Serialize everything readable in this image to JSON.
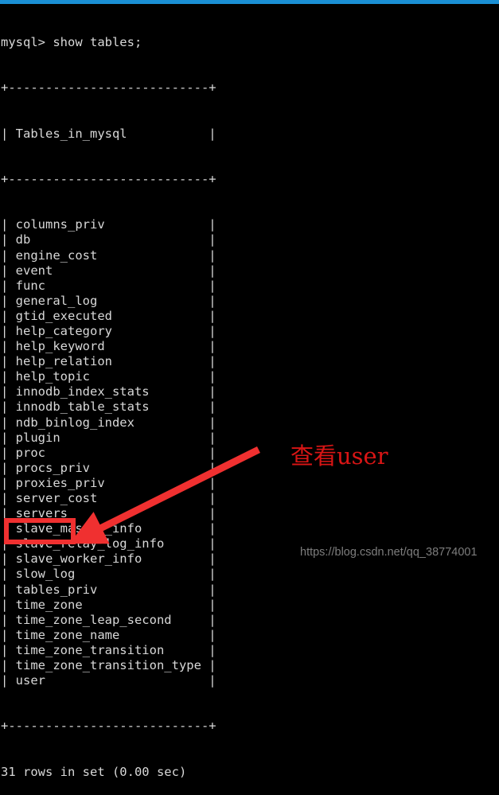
{
  "window": {
    "top_bar_color": "#1a8fd4",
    "background_color": "#000000",
    "text_color": "#d8d8d8",
    "accent_red": "#f03030"
  },
  "terminal": {
    "prompt_line": "mysql> show tables;",
    "separator": "+---------------------------+",
    "header_row": "| Tables_in_mysql           |",
    "column_header": "Tables_in_mysql",
    "rows": [
      "columns_priv",
      "db",
      "engine_cost",
      "event",
      "func",
      "general_log",
      "gtid_executed",
      "help_category",
      "help_keyword",
      "help_relation",
      "help_topic",
      "innodb_index_stats",
      "innodb_table_stats",
      "ndb_binlog_index",
      "plugin",
      "proc",
      "procs_priv",
      "proxies_priv",
      "server_cost",
      "servers",
      "slave_master_info",
      "slave_relay_log_info",
      "slave_worker_info",
      "slow_log",
      "tables_priv",
      "time_zone",
      "time_zone_leap_second",
      "time_zone_name",
      "time_zone_transition",
      "time_zone_transition_type",
      "user"
    ],
    "status_line": "31 rows in set (0.00 sec)",
    "row_count": 31,
    "elapsed": "0.00 sec"
  },
  "annotations": {
    "note_text": "查看user",
    "note_color": "#d81515",
    "highlight_target": "user",
    "arrow_color": "#f03030"
  },
  "watermark": {
    "text": "https://blog.csdn.net/qq_38774001",
    "color": "#888888"
  }
}
